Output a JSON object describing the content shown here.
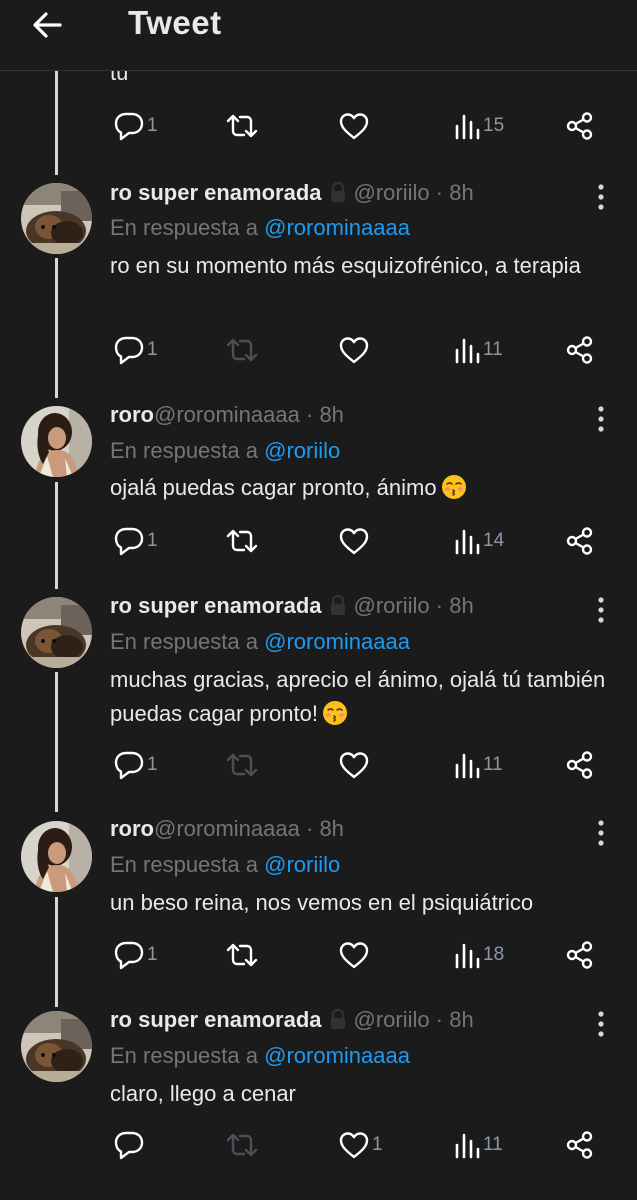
{
  "header": {
    "title": "Tweet"
  },
  "parent": {
    "text_tail": "tu",
    "replies": "1",
    "views": "15"
  },
  "tweets": [
    {
      "name": "ro super enamorada",
      "handle": "@roriilo",
      "sep": "·",
      "time": "8h",
      "reply_prefix": "En respuesta a",
      "reply_to": "@rorominaaaa",
      "text": "ro en su momento más esquizofrénico, a terapia",
      "replies": "1",
      "likes": "",
      "views": "11",
      "retweet_enabled": false,
      "protected": true,
      "emoji": false
    },
    {
      "name": "roro",
      "handle": "@rorominaaaa",
      "sep": "·",
      "time": "8h",
      "reply_prefix": "En respuesta a",
      "reply_to": "@roriilo",
      "text": "ojalá puedas cagar pronto, ánimo",
      "replies": "1",
      "likes": "",
      "views": "14",
      "retweet_enabled": true,
      "protected": false,
      "emoji": true
    },
    {
      "name": "ro super enamorada",
      "handle": "@roriilo",
      "sep": "·",
      "time": "8h",
      "reply_prefix": "En respuesta a",
      "reply_to": "@rorominaaaa",
      "text": "muchas gracias, aprecio el ánimo, ojalá tú también puedas cagar pronto!",
      "replies": "1",
      "likes": "",
      "views": "11",
      "retweet_enabled": false,
      "protected": true,
      "emoji": true
    },
    {
      "name": "roro",
      "handle": "@rorominaaaa",
      "sep": "·",
      "time": "8h",
      "reply_prefix": "En respuesta a",
      "reply_to": "@roriilo",
      "text": "un beso reina, nos vemos en el psiquiátrico",
      "replies": "1",
      "likes": "",
      "views": "18",
      "retweet_enabled": true,
      "protected": false,
      "emoji": false
    },
    {
      "name": "ro super enamorada",
      "handle": "@roriilo",
      "sep": "·",
      "time": "8h",
      "reply_prefix": "En respuesta a",
      "reply_to": "@rorominaaaa",
      "text": "claro, llego a cenar",
      "replies": "",
      "likes": "1",
      "views": "11",
      "retweet_enabled": false,
      "protected": true,
      "emoji": false
    }
  ],
  "icons": {
    "back": "arrow-left-icon",
    "reply": "reply-icon",
    "retweet": "retweet-icon",
    "like": "heart-icon",
    "views": "views-icon",
    "share": "share-icon",
    "more": "more-icon",
    "lock": "lock-icon",
    "emoji": "kissing-face-icon"
  },
  "colors": {
    "background": "#1b1b1b",
    "text": "#e7e9ea",
    "muted": "#71767b",
    "link": "#1d9bf0"
  }
}
